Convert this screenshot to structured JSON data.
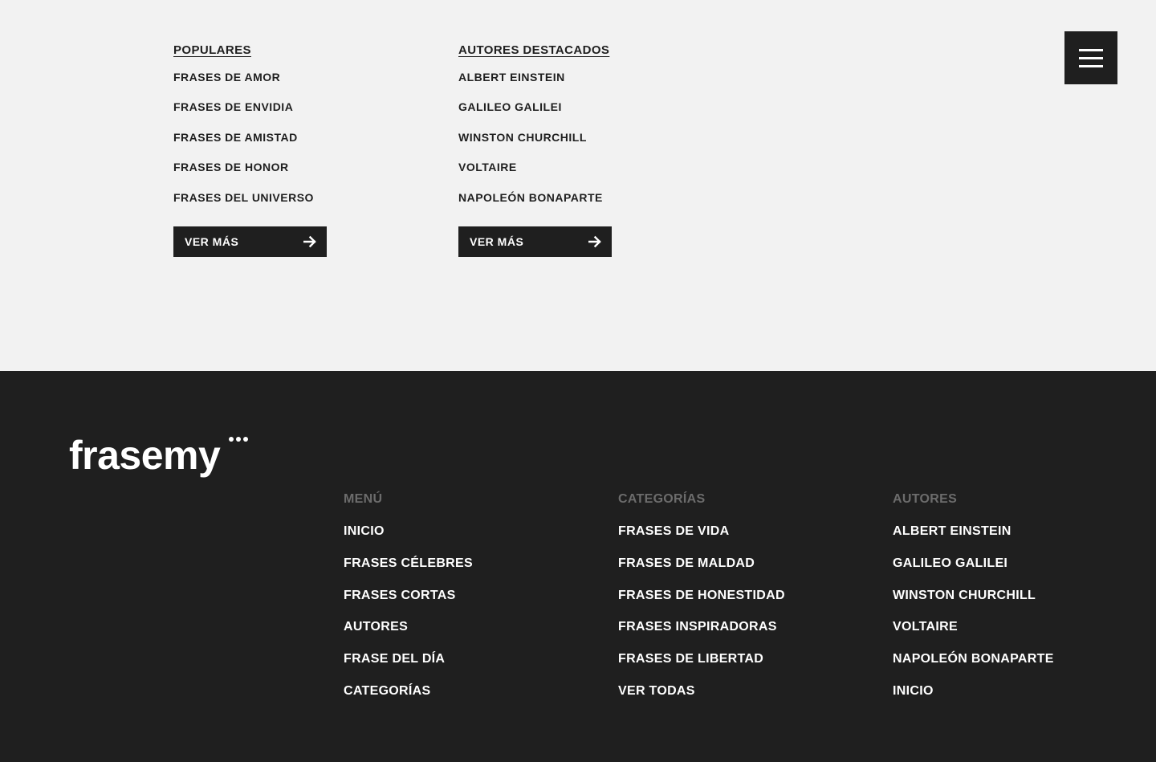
{
  "populares": {
    "title": "POPULARES",
    "items": [
      "FRASES DE AMOR",
      "FRASES DE ENVIDIA",
      "FRASES DE AMISTAD",
      "FRASES DE HONOR",
      "FRASES DEL UNIVERSO"
    ],
    "button_label": "VER MÁS"
  },
  "autores_destacados": {
    "title": "AUTORES DESTACADOS",
    "items": [
      "ALBERT EINSTEIN",
      "GALILEO GALILEI",
      "WINSTON CHURCHILL",
      "VOLTAIRE",
      "NAPOLEÓN BONAPARTE"
    ],
    "button_label": "VER MÁS"
  },
  "header": {
    "menu_icon": "hamburger-menu-icon"
  },
  "footer": {
    "logo": "frasemy",
    "menu": {
      "title": "MENÚ",
      "items": [
        "INICIO",
        "FRASES CÉLEBRES",
        "FRASES CORTAS",
        "AUTORES",
        "FRASE DEL DÍA",
        "CATEGORÍAS"
      ]
    },
    "categorias": {
      "title": "CATEGORÍAS",
      "items": [
        "FRASES DE VIDA",
        "FRASES DE MALDAD",
        "FRASES DE HONESTIDAD",
        "FRASES INSPIRADORAS",
        "FRASES DE LIBERTAD",
        "VER TODAS"
      ]
    },
    "autores": {
      "title": "AUTORES",
      "items": [
        "ALBERT EINSTEIN",
        "GALILEO GALILEI",
        "WINSTON CHURCHILL",
        "VOLTAIRE",
        "NAPOLEÓN BONAPARTE",
        "INICIO"
      ]
    }
  },
  "colors": {
    "dark": "#1f1f1f",
    "light": "#f2f2f2",
    "muted": "#6c6c6c",
    "white": "#ffffff"
  }
}
